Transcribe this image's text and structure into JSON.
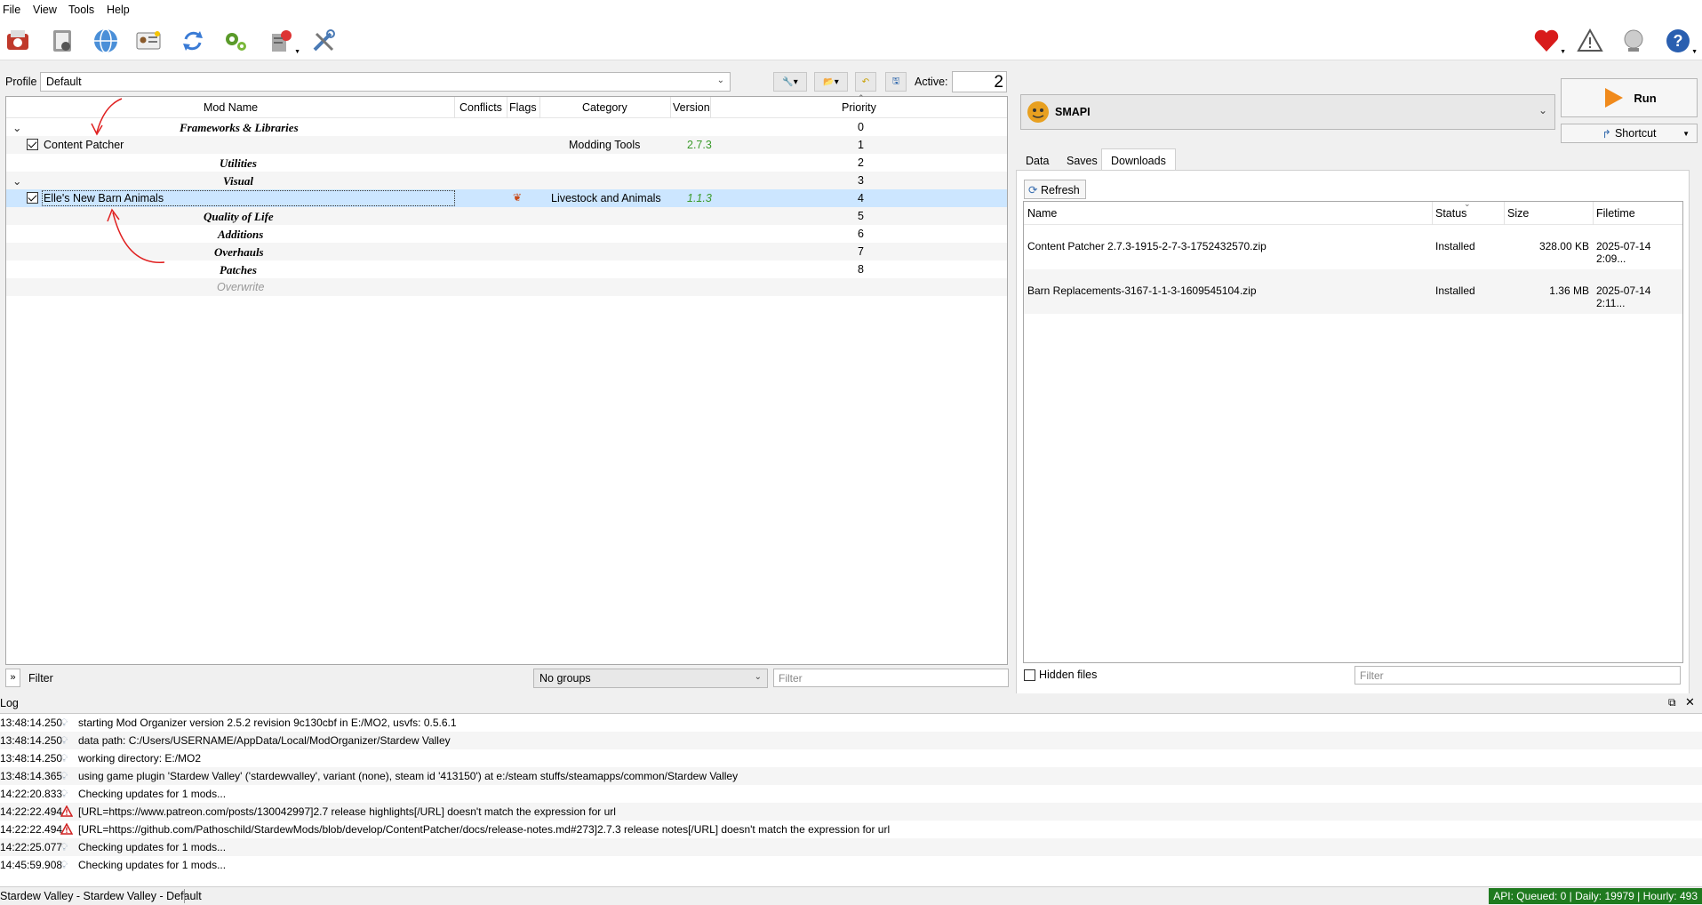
{
  "menu": {
    "file": "File",
    "view": "View",
    "tools": "Tools",
    "help": "Help"
  },
  "profile": {
    "label": "Profile",
    "value": "Default",
    "active_label": "Active:",
    "active_value": "2"
  },
  "modlist": {
    "columns": {
      "name": "Mod Name",
      "conflicts": "Conflicts",
      "flags": "Flags",
      "category": "Category",
      "version": "Version",
      "priority": "Priority"
    },
    "rows": [
      {
        "type": "separator",
        "name": "Frameworks & Libraries",
        "priority": "0"
      },
      {
        "type": "mod",
        "name": "Content Patcher",
        "category": "Modding Tools",
        "version": "2.7.3",
        "priority": "1"
      },
      {
        "type": "separator",
        "name": "Utilities",
        "priority": "2"
      },
      {
        "type": "separator",
        "name": "Visual",
        "priority": "3"
      },
      {
        "type": "mod",
        "name": "Elle's New Barn Animals",
        "category": "Livestock and Animals",
        "version": "1.1.3",
        "priority": "4"
      },
      {
        "type": "separator",
        "name": "Quality of Life",
        "priority": "5"
      },
      {
        "type": "separator",
        "name": "Additions",
        "priority": "6"
      },
      {
        "type": "separator",
        "name": "Overhauls",
        "priority": "7"
      },
      {
        "type": "separator",
        "name": "Patches",
        "priority": "8"
      },
      {
        "type": "overwrite",
        "name": "Overwrite",
        "priority": ""
      }
    ],
    "filter_toggle": "»",
    "filter_label": "Filter",
    "groups_value": "No groups",
    "filter_placeholder": "Filter"
  },
  "executable": {
    "name": "SMAPI",
    "run_label": "Run",
    "shortcut_label": "Shortcut"
  },
  "tabs": {
    "data": "Data",
    "saves": "Saves",
    "downloads": "Downloads"
  },
  "downloads": {
    "refresh_label": "Refresh",
    "columns": {
      "name": "Name",
      "status": "Status",
      "size": "Size",
      "filetime": "Filetime"
    },
    "rows": [
      {
        "name": "Content Patcher 2.7.3-1915-2-7-3-1752432570.zip",
        "status": "Installed",
        "size": "328.00 KB",
        "filetime": "2025-07-14 2:09..."
      },
      {
        "name": "Barn Replacements-3167-1-1-3-1609545104.zip",
        "status": "Installed",
        "size": "1.36 MB",
        "filetime": "2025-07-14 2:11..."
      }
    ],
    "hidden_files_label": "Hidden files",
    "filter_placeholder": "Filter"
  },
  "log": {
    "title": "Log",
    "entries": [
      {
        "time": "13:48:14.250",
        "level": "info",
        "text": "starting Mod Organizer version 2.5.2 revision 9c130cbf in E:/MO2, usvfs: 0.5.6.1"
      },
      {
        "time": "13:48:14.250",
        "level": "info",
        "text": "data path: C:/Users/USERNAME/AppData/Local/ModOrganizer/Stardew Valley"
      },
      {
        "time": "13:48:14.250",
        "level": "info",
        "text": "working directory: E:/MO2"
      },
      {
        "time": "13:48:14.365",
        "level": "info",
        "text": "using game plugin 'Stardew Valley' ('stardewvalley', variant (none), steam id '413150') at e:/steam stuffs/steamapps/common/Stardew Valley"
      },
      {
        "time": "14:22:20.833",
        "level": "info",
        "text": "Checking updates for 1 mods..."
      },
      {
        "time": "14:22:22.494",
        "level": "warning",
        "text": "[URL=https://www.patreon.com/posts/130042997]2.7 release highlights[/URL] doesn't match the expression for url"
      },
      {
        "time": "14:22:22.494",
        "level": "warning",
        "text": "[URL=https://github.com/Pathoschild/StardewMods/blob/develop/ContentPatcher/docs/release-notes.md#273]2.7.3 release notes[/URL] doesn't match the expression for url"
      },
      {
        "time": "14:22:25.077",
        "level": "info",
        "text": "Checking updates for 1 mods..."
      },
      {
        "time": "14:45:59.908",
        "level": "info",
        "text": "Checking updates for 1 mods..."
      }
    ]
  },
  "status": {
    "left": "Stardew Valley - Stardew Valley - Default",
    "api": "API: Queued: 0 | Daily: 19979 | Hourly: 493"
  },
  "colors": {
    "version_green": "#3a9a2a",
    "selection": "#cce6ff",
    "api_green": "#1f7a1f",
    "annotation_red": "#e02020"
  }
}
